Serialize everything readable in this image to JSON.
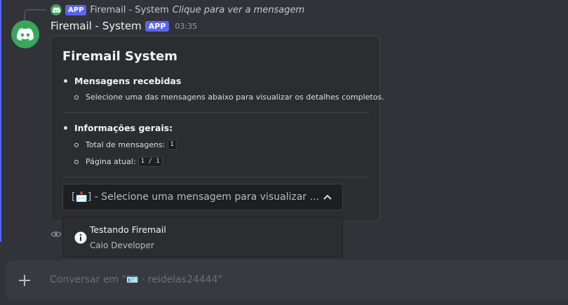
{
  "reply": {
    "app_tag": "APP",
    "name": "Firemail - System",
    "preview": "Clique para ver a mensagem"
  },
  "message": {
    "username": "Firemail - System",
    "app_tag": "APP",
    "timestamp": "03:35"
  },
  "embed": {
    "title": "Firemail System",
    "section1": {
      "heading": "Mensagens recebidas",
      "item": "Selecione uma das mensagens abaixo para visualizar os detalhes completos."
    },
    "section2": {
      "heading": "Informações gerais:",
      "total_label": "Total de mensagens:",
      "total_value": "1",
      "page_label": "Página atual:",
      "page_value": "1 / 1"
    }
  },
  "select": {
    "placeholder": "[📩] - Selecione uma mensagem para visualizar os detalhes"
  },
  "dropdown": {
    "options": [
      {
        "label": "Testando Firemail",
        "description": "Caio Developer"
      }
    ]
  },
  "composer": {
    "placeholder": "Conversar em \"🪪 · reidelas24444\""
  },
  "colors": {
    "accent": "#5865f2",
    "avatar_bg": "#3ba55c",
    "background": "#313338",
    "embed_bg": "#2b2d31"
  },
  "icons": [
    "discord-logo-icon",
    "chevron-up-icon",
    "info-icon",
    "eye-icon",
    "plus-icon"
  ]
}
